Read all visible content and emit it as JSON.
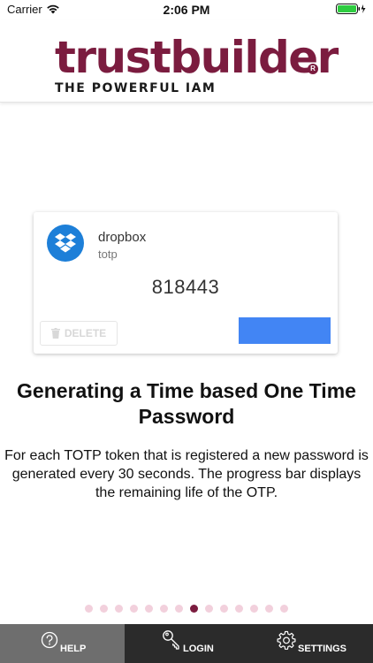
{
  "status_bar": {
    "carrier": "Carrier",
    "time": "2:06 PM",
    "battery_color": "#2ecc40"
  },
  "header": {
    "logo_text": "trustbuilder",
    "logo_mark": "R",
    "tagline": "THE POWERFUL IAM",
    "brand_color": "#7b1c3f"
  },
  "token_card": {
    "icon": "dropbox-icon",
    "name": "dropbox",
    "type": "totp",
    "code": "818443",
    "delete_label": "DELETE",
    "progress_fraction": 1.0,
    "progress_color": "#4285f4"
  },
  "help": {
    "title": "Generating a Time based One Time Password",
    "description": "For each TOTP token that is registered a new password is generated every 30 seconds. The progress bar displays the remaining life of the OTP."
  },
  "pager": {
    "total": 14,
    "active_index": 7
  },
  "tabbar": {
    "tabs": [
      {
        "label": "HELP",
        "icon": "help-circle-icon",
        "active": true
      },
      {
        "label": "LOGIN",
        "icon": "key-icon",
        "active": false
      },
      {
        "label": "SETTINGS",
        "icon": "gear-icon",
        "active": false
      }
    ]
  }
}
